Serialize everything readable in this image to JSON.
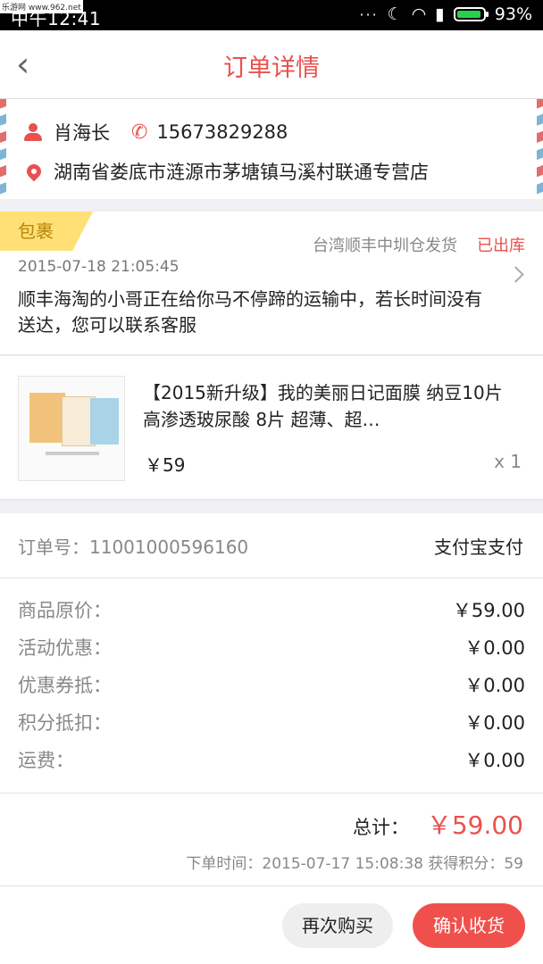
{
  "status": {
    "time": "中午12:41",
    "battery": "93%",
    "battery_level": 0.93,
    "watermark": "乐游网 www.962.net"
  },
  "header": {
    "title": "订单详情"
  },
  "address": {
    "name": "肖海长",
    "phone": "15673829288",
    "address": "湖南省娄底市涟源市茅塘镇马溪村联通专营店"
  },
  "package": {
    "tag": "包裹",
    "warehouse": "台湾顺丰中圳仓发货",
    "state": "已出库",
    "time": "2015-07-18 21:05:45",
    "message": "顺丰海淘的小哥正在给你马不停蹄的运输中，若长时间没有送达，您可以联系客服"
  },
  "product": {
    "name": "【2015新升级】我的美丽日记面膜 纳豆10片 高渗透玻尿酸 8片 超薄、超…",
    "price": "￥59",
    "qty": "x 1"
  },
  "order": {
    "number": "订单号：11001000596160",
    "payment": "支付宝支付"
  },
  "prices": [
    {
      "label": "商品原价：",
      "value": "￥59.00"
    },
    {
      "label": "活动优惠：",
      "value": "￥0.00"
    },
    {
      "label": "优惠券抵：",
      "value": "￥0.00"
    },
    {
      "label": "积分抵扣：",
      "value": "￥0.00"
    },
    {
      "label": "运费：",
      "value": "￥0.00"
    }
  ],
  "total": {
    "label": "总计：",
    "value": "￥59.00",
    "meta": "下单时间：2015-07-17 15:08:38   获得积分：59"
  },
  "actions": {
    "buy_again": "再次购买",
    "confirm": "确认收货"
  },
  "colors": {
    "accent": "#e8524e",
    "tag": "#ffe076",
    "battery": "#29d14a"
  }
}
